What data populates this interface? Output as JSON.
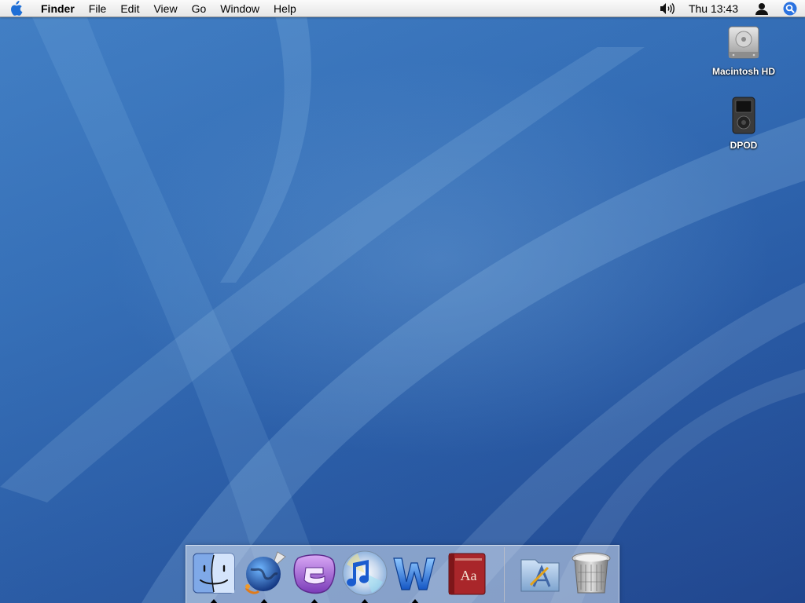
{
  "menubar": {
    "apple_icon": "apple-logo",
    "app_name": "Finder",
    "menus": [
      "File",
      "Edit",
      "View",
      "Go",
      "Window",
      "Help"
    ],
    "status": {
      "volume_icon": "speaker-volume-icon",
      "clock": "Thu 13:43",
      "user_icon": "user-silhouette-icon",
      "spotlight_icon": "spotlight-magnifier-icon"
    }
  },
  "desktop_icons": [
    {
      "label": "Macintosh HD",
      "icon": "hard-drive-icon"
    },
    {
      "label": "DPOD",
      "icon": "ipod-icon"
    }
  ],
  "dock": {
    "apps": [
      {
        "icon": "finder-face-icon",
        "running": true
      },
      {
        "icon": "globe-browser-icon",
        "running": true
      },
      {
        "icon": "purple-e-app-icon",
        "running": true
      },
      {
        "icon": "itunes-cd-icon",
        "running": true
      },
      {
        "icon": "blue-w-app-icon",
        "running": true
      },
      {
        "icon": "dictionary-book-icon",
        "running": false
      }
    ],
    "folders": [
      {
        "icon": "applications-folder-icon"
      },
      {
        "icon": "trash-can-icon"
      }
    ],
    "dictionary_label": "Aa"
  },
  "colors": {
    "menubar": "#eeeeee",
    "apple_logo": "#1f6fd6",
    "desktop_base": "#2a5ea6",
    "desktop_label": "#ffffff"
  }
}
